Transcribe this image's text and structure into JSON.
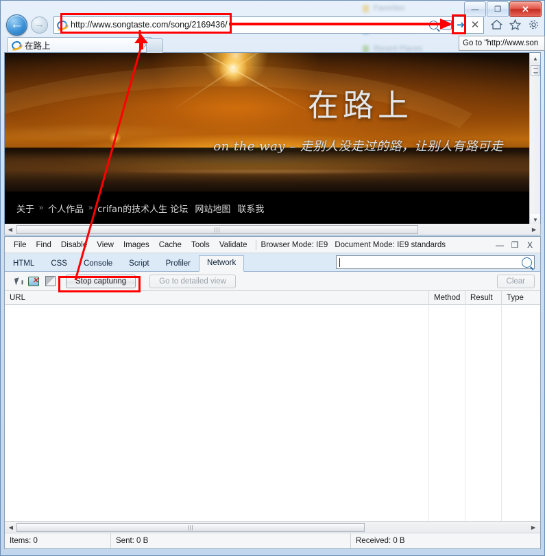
{
  "window": {
    "minimize_label": "—",
    "restore_label": "❐",
    "close_label": "✕"
  },
  "browser": {
    "back_label": "←",
    "forward_label": "→",
    "address_value": "http://www.songtaste.com/song/2169436/",
    "address_placeholder": "",
    "search_icon": "search-icon",
    "compat_icon": "compatibility-view-icon",
    "go_icon": "go-arrow-icon",
    "stop_label": "✕",
    "home_icon": "home-icon",
    "favorites_icon": "star-icon",
    "tools_icon": "gear-icon",
    "tooltip_text": "Go to \"http://www.son",
    "tab": {
      "title": "在路上",
      "close_label": "✕",
      "favicon": "ie-logo-icon"
    },
    "newtab_label": ""
  },
  "page": {
    "banner_title": "在路上",
    "banner_subtitle": "on the way – 走别人没走过的路，让别人有路可走",
    "nav_items": [
      {
        "label": "关于",
        "type": "item"
      },
      {
        "label": "»",
        "type": "sep"
      },
      {
        "label": "个人作品",
        "type": "item"
      },
      {
        "label": "»",
        "type": "sep"
      },
      {
        "label": "crifan的技术人生 论坛",
        "type": "item"
      },
      {
        "label": "网站地图",
        "type": "item"
      },
      {
        "label": "联系我",
        "type": "item"
      }
    ],
    "scroll": {
      "up_arrow": "▲",
      "down_arrow": "▼",
      "left_arrow": "◀",
      "right_arrow": "▶",
      "grip": "|||"
    }
  },
  "devtools": {
    "menus": [
      "File",
      "Find",
      "Disable",
      "View",
      "Images",
      "Cache",
      "Tools",
      "Validate"
    ],
    "browser_mode": "Browser Mode: IE9",
    "document_mode": "Document Mode: IE9 standards",
    "window_buttons": {
      "minimize": "—",
      "restore": "❐",
      "close": "X"
    },
    "tabs": [
      {
        "label": "HTML",
        "active": false
      },
      {
        "label": "CSS",
        "active": false
      },
      {
        "label": "Console",
        "active": false
      },
      {
        "label": "Script",
        "active": false
      },
      {
        "label": "Profiler",
        "active": false
      },
      {
        "label": "Network",
        "active": true
      }
    ],
    "search_value": "",
    "search_placeholder": "",
    "toolbar": {
      "select_element_icon": "cursor-select-icon",
      "clear_images_icon": "disable-images-icon",
      "color_icon": "contrast-icon",
      "stop_capturing_label": "Stop capturing",
      "detailed_view_label": "Go to detailed view",
      "clear_label": "Clear"
    },
    "columns": [
      "URL",
      "Method",
      "Result",
      "Type"
    ],
    "rows": [],
    "status": {
      "items": "Items: 0",
      "sent": "Sent: 0 B",
      "received": "Received: 0 B"
    },
    "scroll": {
      "left_arrow": "◀",
      "right_arrow": "▶",
      "grip": "|||"
    }
  },
  "annotations": {
    "accent_color": "#ff0000",
    "boxes": [
      "address-bar-highlight",
      "go-button-highlight",
      "stop-capturing-highlight"
    ],
    "arrows": [
      "address-to-go-arrow",
      "tab-up-arrow",
      "console-to-stop-arrow"
    ]
  },
  "colors": {
    "red_accent": "#ff0000",
    "active_tab_bg": "#f5f6f8",
    "devtools_tabbar_bg": "#dce9f7",
    "page_black": "#000000",
    "banner_orange": "#c2700e"
  }
}
